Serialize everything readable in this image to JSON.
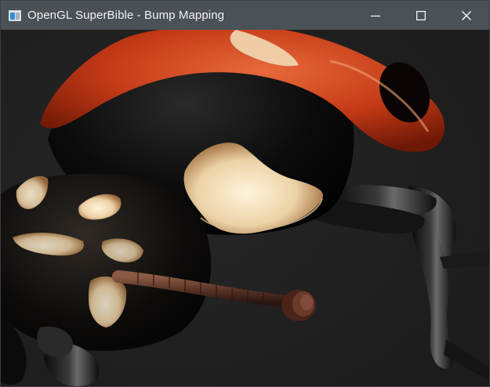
{
  "window": {
    "title": "OpenGL SuperBible - Bump Mapping"
  },
  "icons": {
    "app": "app-window-icon",
    "minimize": "minimize-icon",
    "maximize": "maximize-icon",
    "close": "close-icon"
  },
  "colors": {
    "titlebar": "#4a5157",
    "background": "#1f1f1f",
    "shell_red": "#c8381a",
    "cream_spot": "#f0dcb8"
  }
}
